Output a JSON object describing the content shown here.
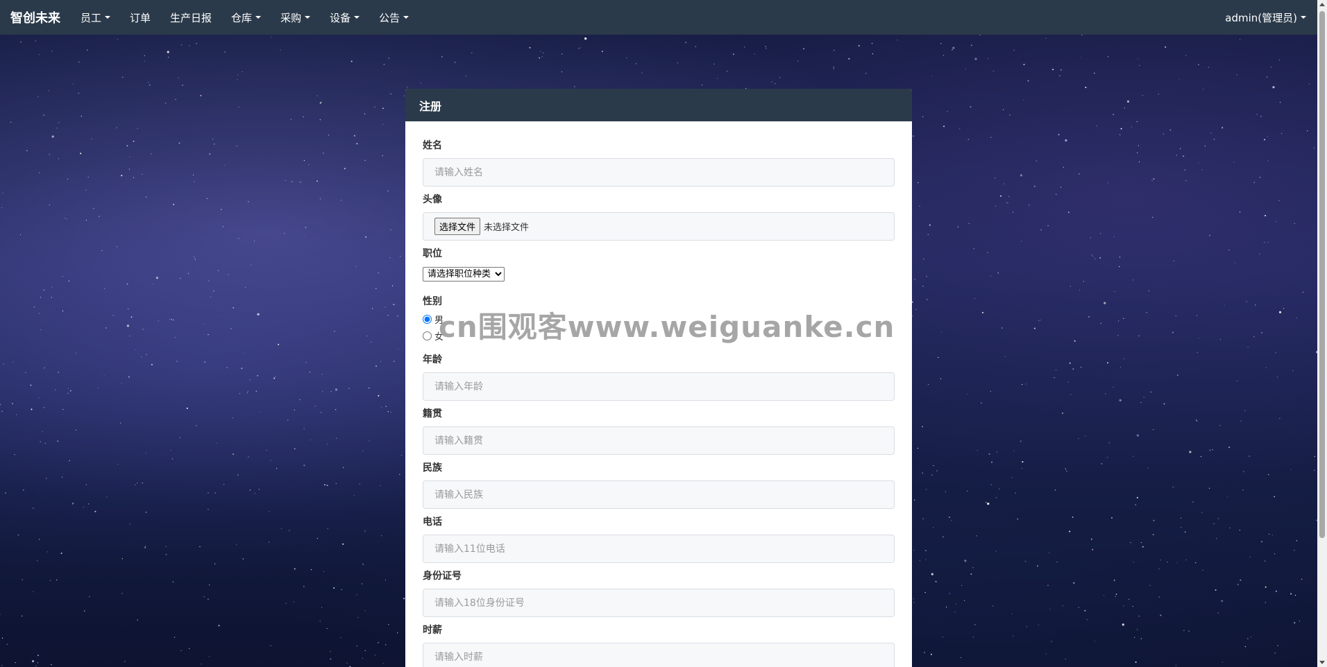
{
  "navbar": {
    "brand": "智创未来",
    "items": [
      {
        "label": "员工",
        "dropdown": true
      },
      {
        "label": "订单",
        "dropdown": false
      },
      {
        "label": "生产日报",
        "dropdown": false
      },
      {
        "label": "仓库",
        "dropdown": true
      },
      {
        "label": "采购",
        "dropdown": true
      },
      {
        "label": "设备",
        "dropdown": true
      },
      {
        "label": "公告",
        "dropdown": true
      }
    ],
    "user": "admin(管理员)"
  },
  "panel": {
    "title": "注册"
  },
  "form": {
    "name": {
      "label": "姓名",
      "placeholder": "请输入姓名",
      "value": ""
    },
    "avatar": {
      "label": "头像",
      "button": "选择文件",
      "status": "未选择文件"
    },
    "position": {
      "label": "职位",
      "selected": "请选择职位种类"
    },
    "gender": {
      "label": "性别",
      "options": [
        {
          "label": "男",
          "checked": true
        },
        {
          "label": "女",
          "checked": false
        }
      ]
    },
    "age": {
      "label": "年龄",
      "placeholder": "请输入年龄",
      "value": ""
    },
    "hometown": {
      "label": "籍贯",
      "placeholder": "请输入籍贯",
      "value": ""
    },
    "ethnicity": {
      "label": "民族",
      "placeholder": "请输入民族",
      "value": ""
    },
    "phone": {
      "label": "电话",
      "placeholder": "请输入11位电话",
      "value": ""
    },
    "id_number": {
      "label": "身份证号",
      "placeholder": "请输入18位身份证号",
      "value": ""
    },
    "hourly_wage": {
      "label": "时薪",
      "placeholder": "请输入时薪",
      "value": ""
    }
  },
  "watermark": "cn围观客www.weiguanke.cn",
  "colors": {
    "navbar_bg": "#2b3a4a",
    "panel_heading_bg": "#2b3a4a",
    "input_bg": "#f7f8fa"
  }
}
